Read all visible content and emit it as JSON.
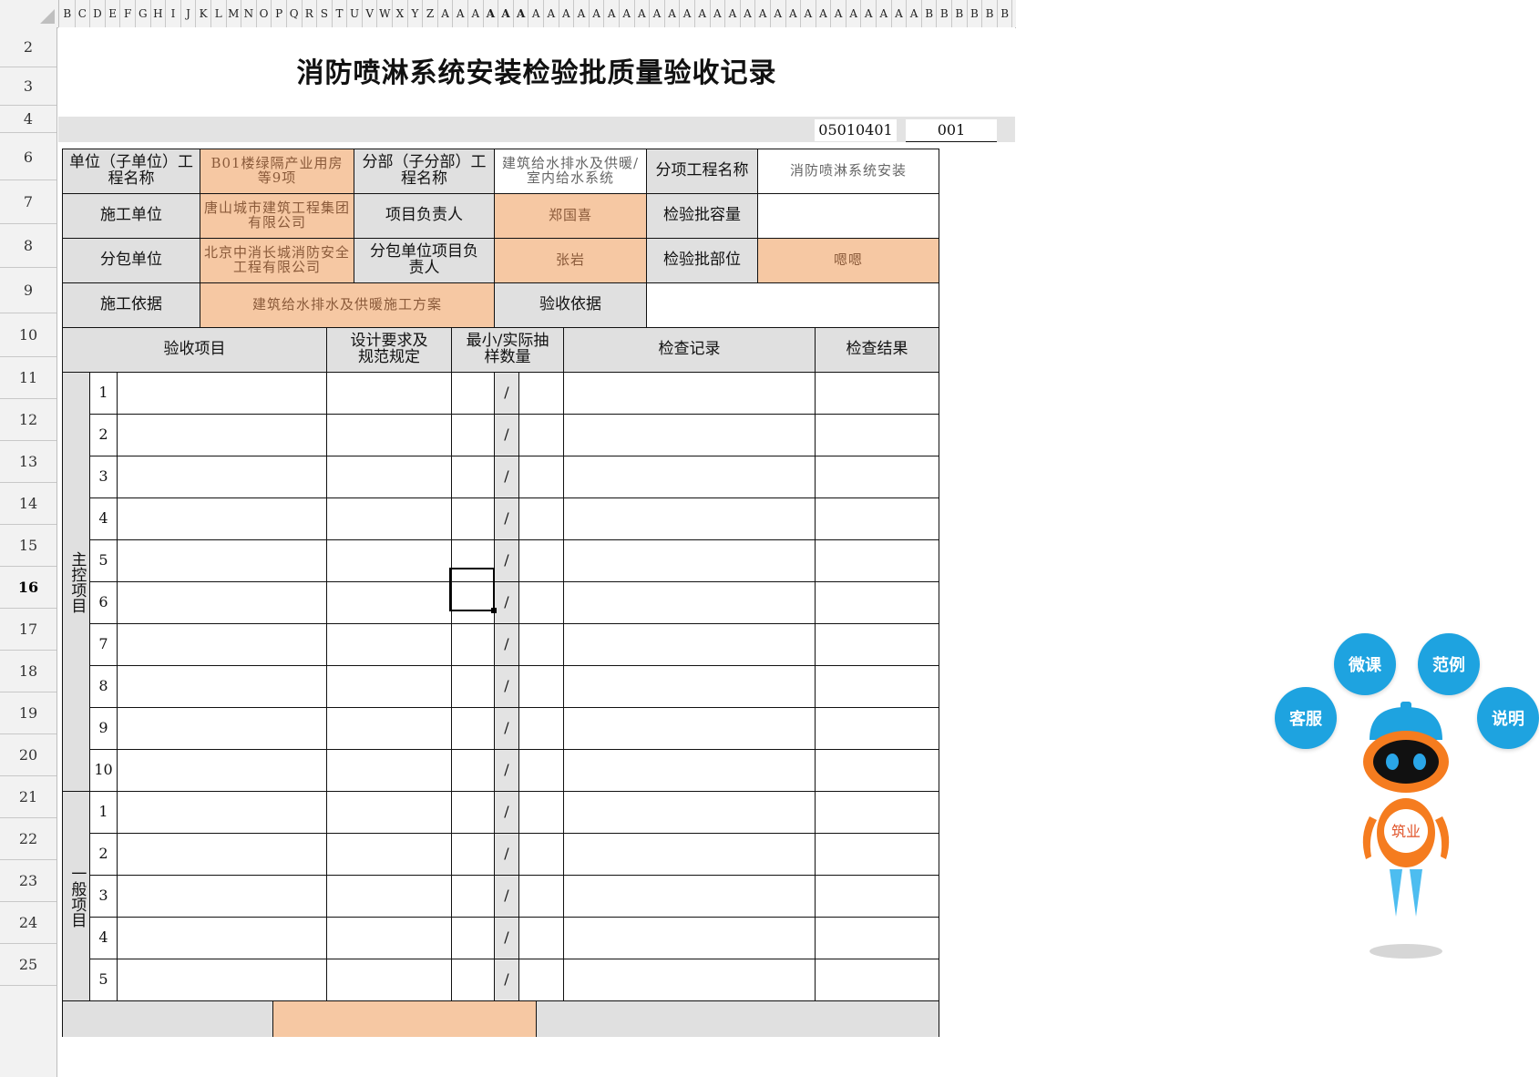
{
  "column_headers": [
    "B",
    "C",
    "D",
    "E",
    "F",
    "G",
    "H",
    "I",
    "J",
    "K",
    "L",
    "M",
    "N",
    "O",
    "P",
    "Q",
    "R",
    "S",
    "T",
    "U",
    "V",
    "W",
    "X",
    "Y",
    "Z",
    "A",
    "A",
    "A",
    "A",
    "A",
    "A",
    "A",
    "A",
    "A",
    "A",
    "A",
    "A",
    "A",
    "A",
    "A",
    "A",
    "A",
    "A",
    "A",
    "A",
    "A",
    "A",
    "A",
    "A",
    "A",
    "A",
    "A",
    "A",
    "A",
    "A",
    "A",
    "A",
    "B",
    "B",
    "B",
    "B",
    "B",
    "B",
    "B",
    "B",
    "B",
    "B",
    "B",
    "B"
  ],
  "row_headers": [
    "2",
    "3",
    "4",
    "6",
    "7",
    "8",
    "9",
    "10",
    "11",
    "12",
    "13",
    "14",
    "15",
    "16",
    "17",
    "18",
    "19",
    "20",
    "21",
    "22",
    "23",
    "24",
    "25"
  ],
  "active_row": "16",
  "form": {
    "title": "消防喷淋系统安装检验批质量验收记录",
    "code": "05010401",
    "serial": "001",
    "unit_label": "单位（子单位）工程名称",
    "unit_value": "B01楼绿隔产业用房等9项",
    "subdiv_label": "分部（子分部）工程名称",
    "subdiv_value": "建筑给水排水及供暖/室内给水系统",
    "item_label": "分项工程名称",
    "item_value": "消防喷淋系统安装",
    "constructor_label": "施工单位",
    "constructor_value": "唐山城市建筑工程集团有限公司",
    "pm_label": "项目负责人",
    "pm_value": "郑国喜",
    "capacity_label": "检验批容量",
    "capacity_value": "",
    "sub_label": "分包单位",
    "sub_value": "北京中消长城消防安全工程有限公司",
    "sub_pm_label": "分包单位项目负责人",
    "sub_pm_value": "张岩",
    "part_label": "检验批部位",
    "part_value": "嗯嗯",
    "basis_label": "施工依据",
    "basis_value": "建筑给水排水及供暖施工方案",
    "accept_basis_label": "验收依据",
    "accept_basis_value": "",
    "table_headers": {
      "item": "验收项目",
      "design": "设计要求及规范规定",
      "sample": "最小/实际抽样数量",
      "record": "检查记录",
      "result": "检查结果"
    },
    "main_category": "主控项目",
    "general_category": "一般项目",
    "main_rows": [
      "1",
      "2",
      "3",
      "4",
      "5",
      "6",
      "7",
      "8",
      "9",
      "10"
    ],
    "general_rows": [
      "1",
      "2",
      "3",
      "4",
      "5"
    ],
    "slash": "/"
  },
  "assistant": {
    "btn_service": "客服",
    "btn_course": "微课",
    "btn_example": "范例",
    "btn_help": "说明",
    "badge_text": "筑业"
  },
  "colors": {
    "label_bg": "#e0e0e0",
    "value_bg": "#f6c8a3",
    "bubble": "#1ea3e0",
    "robot_orange": "#f57c1f"
  }
}
